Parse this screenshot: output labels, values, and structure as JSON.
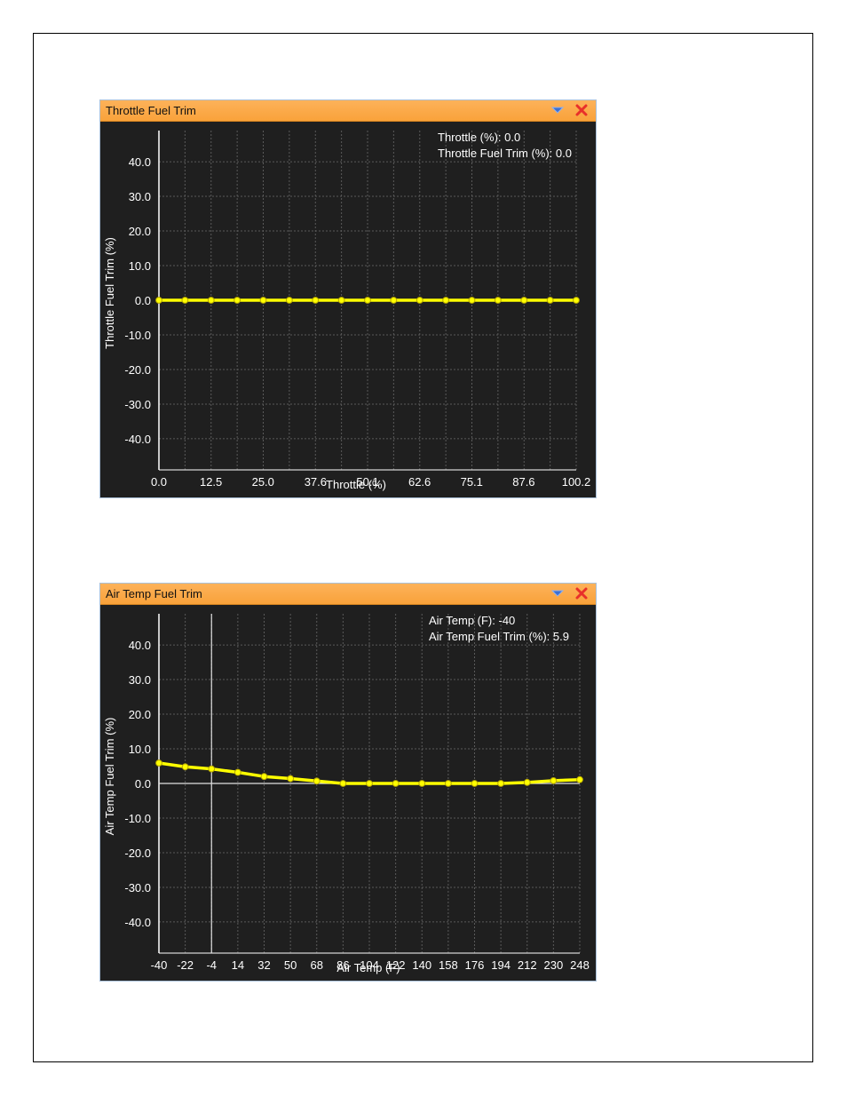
{
  "colors": {
    "header": "#f9a23a",
    "plot_bg": "#1f1f1f",
    "series": "#ffff00",
    "grid": "#5a5a5a",
    "axis": "#ffffff"
  },
  "panels": [
    {
      "title": "Throttle Fuel Trim",
      "readout_x": "Throttle (%): 0.0",
      "readout_y": "Throttle Fuel Trim (%): 0.0",
      "dropdown_icon": "chevron-down-icon",
      "close_icon": "close-icon"
    },
    {
      "title": "Air Temp Fuel Trim",
      "readout_x": "Air Temp (F): -40",
      "readout_y": "Air Temp Fuel Trim (%): 5.9",
      "dropdown_icon": "chevron-down-icon",
      "close_icon": "close-icon"
    }
  ],
  "chart_data": [
    {
      "type": "line",
      "title": "Throttle Fuel Trim",
      "xlabel": "Throttle (%)",
      "ylabel": "Throttle Fuel Trim (%)",
      "xlim": [
        0,
        100.2
      ],
      "ylim": [
        -49,
        49
      ],
      "x_ticks": [
        "0.0",
        "12.5",
        "25.0",
        "37.6",
        "50.1",
        "62.6",
        "75.1",
        "87.6",
        "100.2"
      ],
      "y_ticks": [
        "40.0",
        "30.0",
        "20.0",
        "10.0",
        "0.0",
        "-10.0",
        "-20.0",
        "-30.0",
        "-40.0"
      ],
      "grid": true,
      "crosshair_x": null,
      "series": [
        {
          "x": [
            0.0,
            6.26,
            12.53,
            18.79,
            25.05,
            31.31,
            37.58,
            43.84,
            50.1,
            56.36,
            62.63,
            68.89,
            75.15,
            81.41,
            87.68,
            93.94,
            100.2
          ],
          "values": [
            0,
            0,
            0,
            0,
            0,
            0,
            0,
            0,
            0,
            0,
            0,
            0,
            0,
            0,
            0,
            0,
            0
          ]
        }
      ]
    },
    {
      "type": "line",
      "title": "Air Temp Fuel Trim",
      "xlabel": "Air Temp (F)",
      "ylabel": "Air Temp Fuel Trim (%)",
      "xlim": [
        -40,
        248
      ],
      "ylim": [
        -49,
        49
      ],
      "x_ticks": [
        "-40",
        "-22",
        "-4",
        "14",
        "32",
        "50",
        "68",
        "86",
        "104",
        "122",
        "140",
        "158",
        "176",
        "194",
        "212",
        "230",
        "248"
      ],
      "y_ticks": [
        "40.0",
        "30.0",
        "20.0",
        "10.0",
        "0.0",
        "-10.0",
        "-20.0",
        "-30.0",
        "-40.0"
      ],
      "grid": true,
      "crosshair_x": -4,
      "series": [
        {
          "x": [
            -40,
            -22,
            -4,
            14,
            32,
            50,
            68,
            86,
            104,
            122,
            140,
            158,
            176,
            194,
            212,
            230,
            248
          ],
          "values": [
            5.9,
            4.8,
            4.2,
            3.2,
            2.0,
            1.4,
            0.7,
            0.0,
            0.0,
            0.0,
            0.0,
            0.0,
            0.0,
            0.0,
            0.3,
            0.8,
            1.1
          ]
        }
      ]
    }
  ]
}
